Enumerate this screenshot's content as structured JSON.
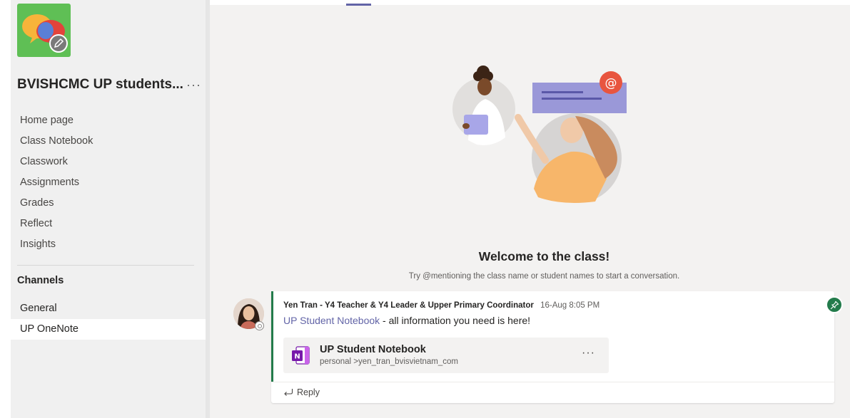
{
  "team": {
    "name": "BVISHCMC UP students...",
    "more_label": "···"
  },
  "nav": {
    "items": [
      {
        "label": "Home page"
      },
      {
        "label": "Class Notebook"
      },
      {
        "label": "Classwork"
      },
      {
        "label": "Assignments"
      },
      {
        "label": "Grades"
      },
      {
        "label": "Reflect"
      },
      {
        "label": "Insights"
      }
    ]
  },
  "channels": {
    "heading": "Channels",
    "items": [
      {
        "label": "General"
      },
      {
        "label": "UP OneNote"
      }
    ],
    "active": "UP OneNote"
  },
  "welcome": {
    "title": "Welcome to the class!",
    "subtitle": "Try @mentioning the class name or student names to start a conversation."
  },
  "post": {
    "author": "Yen Tran - Y4 Teacher & Y4 Leader & Upper Primary Coordinator",
    "time": "16-Aug 8:05 PM",
    "link_text": "UP Student Notebook",
    "body_text": " - all information you need is here!",
    "attachment": {
      "name": "UP Student Notebook",
      "path": "personal >yen_tran_bvisvietnam_com",
      "more_label": "···"
    },
    "reply_label": "Reply"
  },
  "colors": {
    "accent": "#6264a7",
    "post_accent": "#237b4b",
    "team_avatar_bg": "#5fbf55",
    "onenote": "#7719aa",
    "mention": "#e8553f"
  },
  "icons": {
    "team_avatar": "chat-bubbles-icon",
    "edit": "pencil-icon",
    "more": "ellipsis-icon",
    "pin": "pin-icon",
    "attachment": "onenote-icon",
    "reply": "reply-arrow-icon",
    "mention": "at-sign-icon"
  }
}
